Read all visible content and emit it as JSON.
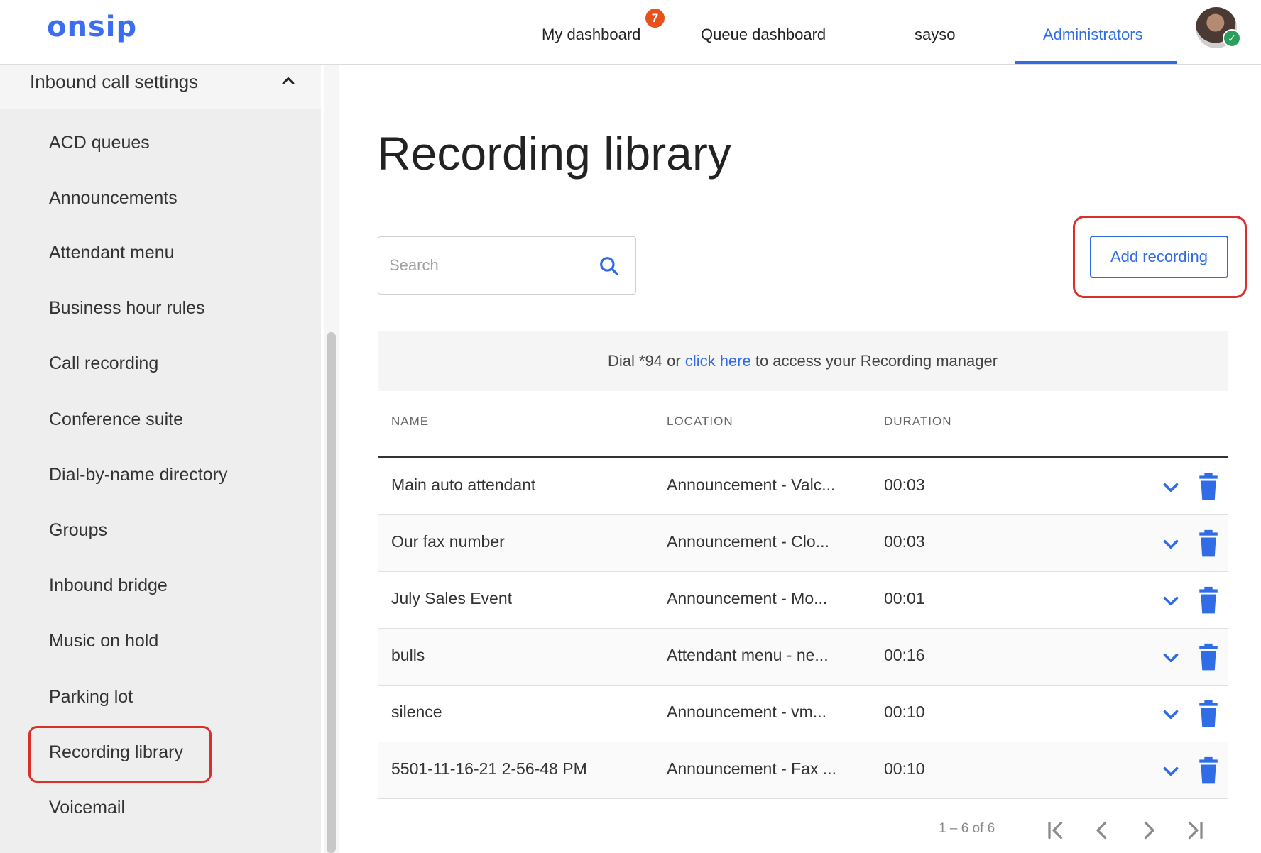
{
  "header": {
    "logo": "onsip",
    "nav": [
      {
        "label": "My dashboard",
        "badge": "7"
      },
      {
        "label": "Queue dashboard"
      },
      {
        "label": "sayso"
      },
      {
        "label": "Administrators",
        "active": true
      }
    ],
    "user_status": "online",
    "accent_color": "#2f6ce5"
  },
  "sidebar": {
    "section_label": "Inbound call settings",
    "section_expanded": true,
    "items": [
      {
        "label": "ACD queues"
      },
      {
        "label": "Announcements"
      },
      {
        "label": "Attendant menu"
      },
      {
        "label": "Business hour rules"
      },
      {
        "label": "Call recording"
      },
      {
        "label": "Conference suite"
      },
      {
        "label": "Dial-by-name directory"
      },
      {
        "label": "Groups"
      },
      {
        "label": "Inbound bridge"
      },
      {
        "label": "Music on hold"
      },
      {
        "label": "Parking lot"
      },
      {
        "label": "Recording library",
        "selected": true
      },
      {
        "label": "Voicemail"
      }
    ]
  },
  "main": {
    "title": "Recording library",
    "search": {
      "placeholder": "Search",
      "value": ""
    },
    "add_button_label": "Add recording",
    "banner": {
      "prefix": "Dial *94 or ",
      "link": "click here",
      "suffix": " to access your Recording manager"
    },
    "table": {
      "columns": [
        "NAME",
        "LOCATION",
        "DURATION"
      ],
      "rows": [
        {
          "name": "Main auto attendant",
          "location": "Announcement - Valc...",
          "duration": "00:03"
        },
        {
          "name": "Our fax number",
          "location": "Announcement - Clo...",
          "duration": "00:03"
        },
        {
          "name": "July Sales Event",
          "location": "Announcement - Mo...",
          "duration": "00:01"
        },
        {
          "name": "bulls",
          "location": "Attendant menu - ne...",
          "duration": "00:16"
        },
        {
          "name": "silence",
          "location": "Announcement - vm...",
          "duration": "00:10"
        },
        {
          "name": "5501-11-16-21 2-56-48 PM",
          "location": "Announcement - Fax ...",
          "duration": "00:10"
        }
      ]
    },
    "pagination": {
      "range": "1 – 6 of 6"
    }
  },
  "highlight_color": "#d9302c"
}
